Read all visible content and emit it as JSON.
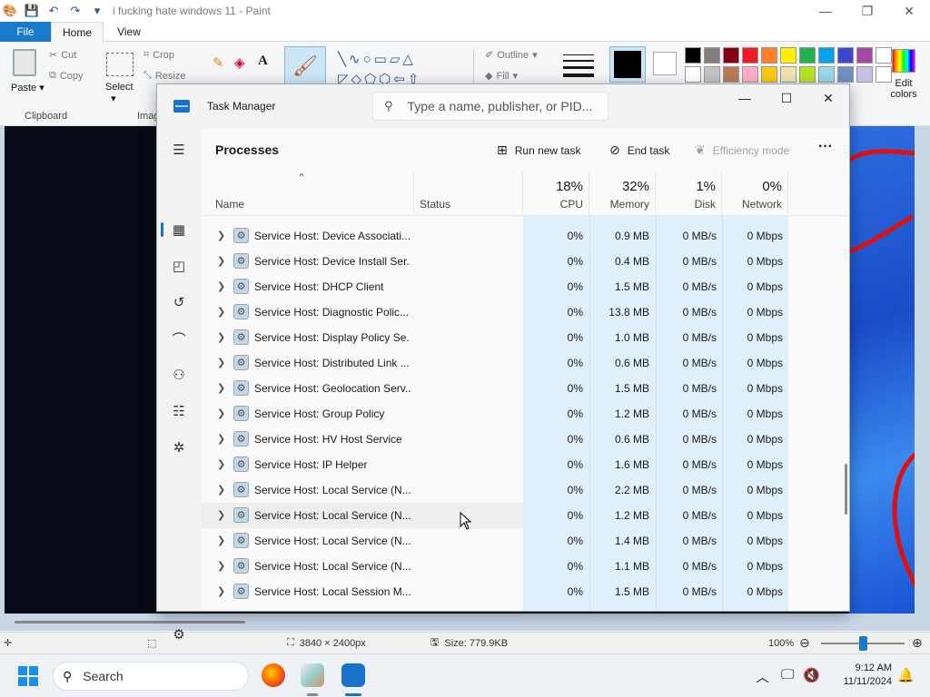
{
  "paint": {
    "title": "i fucking hate windows 11 - Paint",
    "tabs": {
      "file": "File",
      "home": "Home",
      "view": "View"
    },
    "ribbon": {
      "paste": "Paste",
      "cut": "Cut",
      "copy": "Copy",
      "clipboard_group": "Clipboard",
      "select": "Select",
      "crop": "Crop",
      "resize": "Resize",
      "image_group": "Imag",
      "outline": "Outline",
      "fill": "Fill",
      "edit_colors": "Edit colors"
    },
    "palette": [
      "#000000",
      "#7f7f7f",
      "#880015",
      "#ed1c24",
      "#ff7f27",
      "#fff200",
      "#22b14c",
      "#00a2e8",
      "#3f48cc",
      "#a349a4",
      "#ffffff",
      "#ffffff",
      "#c3c3c3",
      "#b97a57",
      "#ffaec9",
      "#ffc90e",
      "#efe4b0",
      "#b5e61d",
      "#99d9ea",
      "#7092be",
      "#c8bfe7",
      "#ffffff"
    ],
    "status": {
      "dimensions": "3840 × 2400px",
      "size": "Size: 779.9KB",
      "zoom": "100%"
    }
  },
  "task_manager": {
    "title": "Task Manager",
    "search_placeholder": "Type a name, publisher, or PID...",
    "page_title": "Processes",
    "commands": {
      "run_new_task": "Run new task",
      "end_task": "End task",
      "efficiency_mode": "Efficiency mode"
    },
    "columns": {
      "name": "Name",
      "status": "Status",
      "cpu_pct": "18%",
      "cpu": "CPU",
      "memory_pct": "32%",
      "memory": "Memory",
      "disk_pct": "1%",
      "disk": "Disk",
      "network_pct": "0%",
      "network": "Network"
    },
    "processes": [
      {
        "name": "Service Host: Device Associati...",
        "cpu": "0%",
        "memory": "0.9 MB",
        "disk": "0 MB/s",
        "network": "0 Mbps"
      },
      {
        "name": "Service Host: Device Install Ser...",
        "cpu": "0%",
        "memory": "0.4 MB",
        "disk": "0 MB/s",
        "network": "0 Mbps"
      },
      {
        "name": "Service Host: DHCP Client",
        "cpu": "0%",
        "memory": "1.5 MB",
        "disk": "0 MB/s",
        "network": "0 Mbps"
      },
      {
        "name": "Service Host: Diagnostic Polic...",
        "cpu": "0%",
        "memory": "13.8 MB",
        "disk": "0 MB/s",
        "network": "0 Mbps"
      },
      {
        "name": "Service Host: Display Policy Se...",
        "cpu": "0%",
        "memory": "1.0 MB",
        "disk": "0 MB/s",
        "network": "0 Mbps"
      },
      {
        "name": "Service Host: Distributed Link ...",
        "cpu": "0%",
        "memory": "0.6 MB",
        "disk": "0 MB/s",
        "network": "0 Mbps"
      },
      {
        "name": "Service Host: Geolocation Serv...",
        "cpu": "0%",
        "memory": "1.5 MB",
        "disk": "0 MB/s",
        "network": "0 Mbps"
      },
      {
        "name": "Service Host: Group Policy",
        "cpu": "0%",
        "memory": "1.2 MB",
        "disk": "0 MB/s",
        "network": "0 Mbps"
      },
      {
        "name": "Service Host: HV Host Service",
        "cpu": "0%",
        "memory": "0.6 MB",
        "disk": "0 MB/s",
        "network": "0 Mbps"
      },
      {
        "name": "Service Host: IP Helper",
        "cpu": "0%",
        "memory": "1.6 MB",
        "disk": "0 MB/s",
        "network": "0 Mbps"
      },
      {
        "name": "Service Host: Local Service (N...",
        "cpu": "0%",
        "memory": "2.2 MB",
        "disk": "0 MB/s",
        "network": "0 Mbps"
      },
      {
        "name": "Service Host: Local Service (N...",
        "cpu": "0%",
        "memory": "1.2 MB",
        "disk": "0 MB/s",
        "network": "0 Mbps"
      },
      {
        "name": "Service Host: Local Service (N...",
        "cpu": "0%",
        "memory": "1.4 MB",
        "disk": "0 MB/s",
        "network": "0 Mbps"
      },
      {
        "name": "Service Host: Local Service (N...",
        "cpu": "0%",
        "memory": "1.1 MB",
        "disk": "0 MB/s",
        "network": "0 Mbps"
      },
      {
        "name": "Service Host: Local Session M...",
        "cpu": "0%",
        "memory": "1.5 MB",
        "disk": "0 MB/s",
        "network": "0 Mbps"
      }
    ]
  },
  "taskbar": {
    "search_placeholder": "Search",
    "time": "9:12 AM",
    "date": "11/11/2024"
  }
}
